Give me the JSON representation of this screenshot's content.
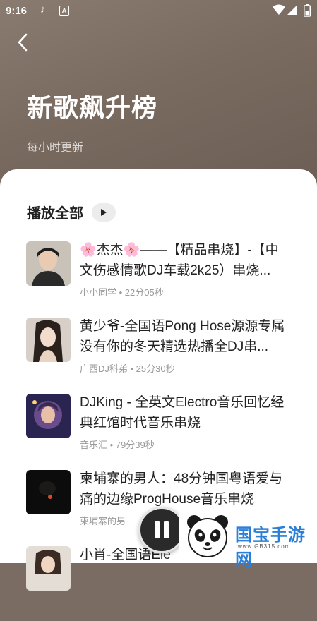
{
  "status": {
    "time": "9:16",
    "app_icon": "tiktok-icon",
    "a_icon": "A"
  },
  "header": {
    "title": "新歌飙升榜",
    "subtitle": "每小时更新"
  },
  "play_all": {
    "label": "播放全部"
  },
  "songs": [
    {
      "title": "🌸杰杰🌸——【精品串烧】-【中文伤感情歌DJ车载2k25）串烧...",
      "meta": "小小同学 • 22分05秒"
    },
    {
      "title": "黄少爷-全国语Pong Hose源源专属没有你的冬天精选热播全DJ串...",
      "meta": "广西DJ科弟 • 25分30秒"
    },
    {
      "title": "DJKing - 全英文Electro音乐回忆经典红馆时代音乐串烧",
      "meta": "音乐汇 • 79分39秒"
    },
    {
      "title": "柬埔寨的男人：48分钟国粤语爱与痛的边缘ProgHouse音乐串烧",
      "meta": "柬埔寨的男"
    },
    {
      "title": "小肖-全国语Ele",
      "meta": ""
    }
  ],
  "watermark": {
    "text": "国宝手游网",
    "url": "www.GB315.com"
  },
  "colors": {
    "header_bg": "#7a6b60",
    "accent_blue": "#2b7fd8"
  }
}
